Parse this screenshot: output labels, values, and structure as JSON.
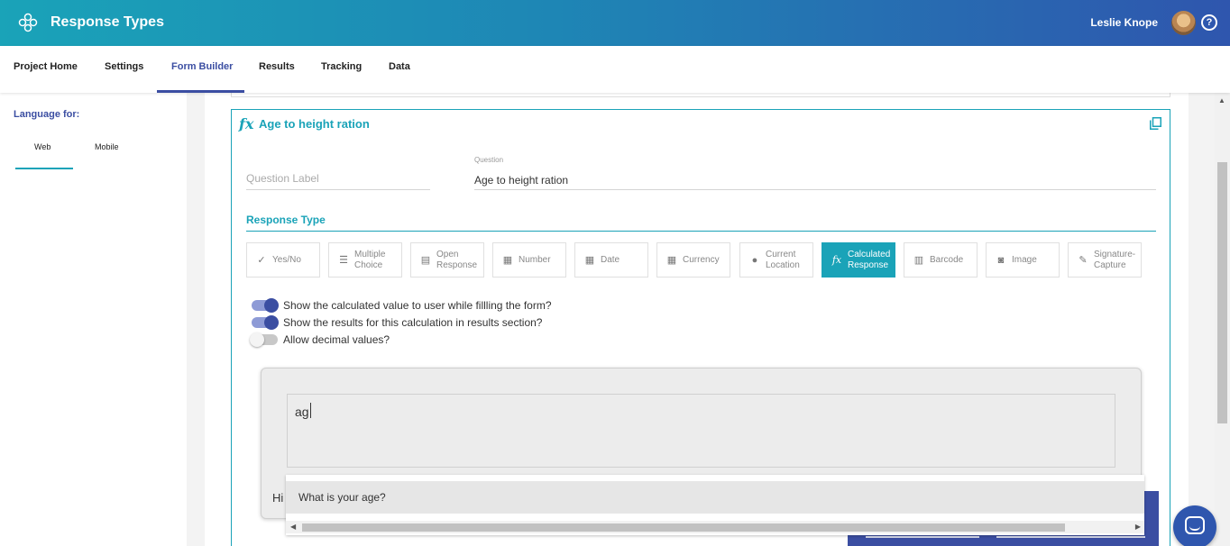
{
  "header": {
    "title": "Response Types",
    "user_name": "Leslie Knope"
  },
  "nav": {
    "items": [
      {
        "label": "Project Home"
      },
      {
        "label": "Settings"
      },
      {
        "label": "Form Builder"
      },
      {
        "label": "Results"
      },
      {
        "label": "Tracking"
      },
      {
        "label": "Data"
      }
    ],
    "active": "Form Builder"
  },
  "sidebar": {
    "language_label": "Language for:",
    "tabs": [
      {
        "label": "Web"
      },
      {
        "label": "Mobile"
      }
    ],
    "active_tab": "Web"
  },
  "question_card": {
    "title": "Age to height ration",
    "question_label_placeholder": "Question Label",
    "question_field_label": "Question",
    "question_value": "Age to height ration",
    "response_type_heading": "Response Type",
    "response_types": [
      {
        "label": "Yes/No",
        "icon": "yes-no-icon"
      },
      {
        "label": "Multiple Choice",
        "icon": "list-icon"
      },
      {
        "label": "Open Response",
        "icon": "text-box-icon"
      },
      {
        "label": "Number",
        "icon": "calculator-icon"
      },
      {
        "label": "Date",
        "icon": "calendar-icon"
      },
      {
        "label": "Currency",
        "icon": "calculator-icon"
      },
      {
        "label": "Current Location",
        "icon": "location-pin-icon"
      },
      {
        "label": "Calculated Response",
        "icon": "fx-icon"
      },
      {
        "label": "Barcode",
        "icon": "barcode-icon"
      },
      {
        "label": "Image",
        "icon": "camera-icon"
      },
      {
        "label": "Signature-Capture",
        "icon": "pen-icon"
      }
    ],
    "selected_response_type": "Calculated Response",
    "toggles": [
      {
        "label": "Show the calculated value to user while fillling the form?",
        "on": true
      },
      {
        "label": "Show the results for this calculation in results section?",
        "on": true
      },
      {
        "label": "Allow decimal values?",
        "on": false
      }
    ],
    "formula": {
      "value": "ag",
      "hint_fragment": "Hi",
      "suggestions": [
        "What is your age?"
      ]
    }
  },
  "colors": {
    "primary": "#1aa3b8",
    "secondary": "#3b4ea2"
  }
}
